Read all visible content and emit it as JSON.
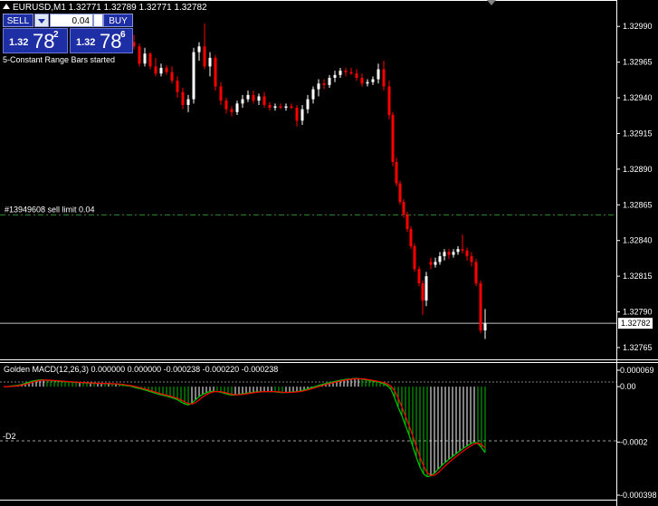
{
  "window": {
    "title": "EURUSD,M1  1.32771 1.32789 1.32771 1.32782"
  },
  "trade_panel": {
    "sell_label": "SELL",
    "buy_label": "BUY",
    "lot_value": "0.04",
    "bid_prefix": "1.32",
    "bid_big": "78",
    "bid_sup": "2",
    "ask_prefix": "1.32",
    "ask_big": "78",
    "ask_sup": "6"
  },
  "journal_text": "5-Constant Range Bars started",
  "order_line": {
    "label": "#13949608 sell limit 0.04",
    "price": 1.32858
  },
  "price_axis": {
    "ticks": [
      "1.32990",
      "1.32965",
      "1.32940",
      "1.32915",
      "1.32890",
      "1.32865",
      "1.32840",
      "1.32815",
      "1.32790",
      "1.32765"
    ],
    "current_price_label": "1.32782",
    "current_price": 1.32782
  },
  "indicator": {
    "label": "Golden MACD(12,26,3) 0.000000 0.000000 -0.000238 -0.000220 -0.000238",
    "level_label": "-D2",
    "axis_ticks": [
      "0.000069",
      "0.00",
      "-0.0002",
      "-0.000398"
    ]
  },
  "colors": {
    "background": "#000000",
    "bull_candle": "#ffffff",
    "bear_candle": "#ff0000",
    "order_line": "#2e8b2e",
    "macd_up": "#ffffff",
    "macd_down": "#00c000",
    "signal": "#ff0000",
    "panel_blue": "#1e2fa5"
  },
  "chart_data": {
    "type": "candlestick",
    "ylim": [
      1.32758,
      1.33006
    ],
    "candles": [
      {
        "x": 148,
        "o": 1.32979,
        "h": 1.32984,
        "l": 1.32974,
        "c": 1.32976
      },
      {
        "x": 154,
        "o": 1.32976,
        "h": 1.32978,
        "l": 1.32962,
        "c": 1.32964
      },
      {
        "x": 160,
        "o": 1.32964,
        "h": 1.32975,
        "l": 1.32962,
        "c": 1.32971
      },
      {
        "x": 166,
        "o": 1.32971,
        "h": 1.32972,
        "l": 1.3296,
        "c": 1.32962
      },
      {
        "x": 172,
        "o": 1.32962,
        "h": 1.32968,
        "l": 1.32955,
        "c": 1.32957
      },
      {
        "x": 178,
        "o": 1.32957,
        "h": 1.32964,
        "l": 1.32955,
        "c": 1.32961
      },
      {
        "x": 184,
        "o": 1.32961,
        "h": 1.32963,
        "l": 1.32956,
        "c": 1.32958
      },
      {
        "x": 190,
        "o": 1.32958,
        "h": 1.32962,
        "l": 1.3295,
        "c": 1.32952
      },
      {
        "x": 196,
        "o": 1.32952,
        "h": 1.32955,
        "l": 1.3294,
        "c": 1.32944
      },
      {
        "x": 202,
        "o": 1.32944,
        "h": 1.32947,
        "l": 1.32932,
        "c": 1.32935
      },
      {
        "x": 208,
        "o": 1.32935,
        "h": 1.32942,
        "l": 1.3293,
        "c": 1.32939
      },
      {
        "x": 214,
        "o": 1.32939,
        "h": 1.32975,
        "l": 1.32936,
        "c": 1.32972
      },
      {
        "x": 220,
        "o": 1.32972,
        "h": 1.32979,
        "l": 1.32966,
        "c": 1.32976
      },
      {
        "x": 226,
        "o": 1.32976,
        "h": 1.32992,
        "l": 1.3296,
        "c": 1.32962
      },
      {
        "x": 232,
        "o": 1.32962,
        "h": 1.32972,
        "l": 1.32955,
        "c": 1.32968
      },
      {
        "x": 238,
        "o": 1.32968,
        "h": 1.3297,
        "l": 1.32945,
        "c": 1.32948
      },
      {
        "x": 244,
        "o": 1.32948,
        "h": 1.32951,
        "l": 1.32935,
        "c": 1.32938
      },
      {
        "x": 250,
        "o": 1.32938,
        "h": 1.3294,
        "l": 1.32929,
        "c": 1.32932
      },
      {
        "x": 256,
        "o": 1.32932,
        "h": 1.32934,
        "l": 1.32927,
        "c": 1.3293
      },
      {
        "x": 262,
        "o": 1.3293,
        "h": 1.32938,
        "l": 1.32928,
        "c": 1.32936
      },
      {
        "x": 268,
        "o": 1.32936,
        "h": 1.32942,
        "l": 1.32933,
        "c": 1.32939
      },
      {
        "x": 274,
        "o": 1.32939,
        "h": 1.32945,
        "l": 1.32937,
        "c": 1.32942
      },
      {
        "x": 280,
        "o": 1.32942,
        "h": 1.32945,
        "l": 1.32936,
        "c": 1.32938
      },
      {
        "x": 286,
        "o": 1.32938,
        "h": 1.32943,
        "l": 1.32935,
        "c": 1.32941
      },
      {
        "x": 292,
        "o": 1.32941,
        "h": 1.32944,
        "l": 1.32933,
        "c": 1.32935
      },
      {
        "x": 298,
        "o": 1.32935,
        "h": 1.32937,
        "l": 1.32931,
        "c": 1.32933
      },
      {
        "x": 304,
        "o": 1.32933,
        "h": 1.32936,
        "l": 1.32931,
        "c": 1.32934
      },
      {
        "x": 310,
        "o": 1.32934,
        "h": 1.32936,
        "l": 1.32932,
        "c": 1.32933
      },
      {
        "x": 316,
        "o": 1.32933,
        "h": 1.32936,
        "l": 1.32931,
        "c": 1.32934
      },
      {
        "x": 322,
        "o": 1.32934,
        "h": 1.32936,
        "l": 1.32932,
        "c": 1.32933
      },
      {
        "x": 328,
        "o": 1.32933,
        "h": 1.32935,
        "l": 1.3292,
        "c": 1.32924
      },
      {
        "x": 334,
        "o": 1.32924,
        "h": 1.32935,
        "l": 1.32921,
        "c": 1.32932
      },
      {
        "x": 340,
        "o": 1.32932,
        "h": 1.32942,
        "l": 1.32929,
        "c": 1.32939
      },
      {
        "x": 346,
        "o": 1.32939,
        "h": 1.32948,
        "l": 1.32936,
        "c": 1.32946
      },
      {
        "x": 352,
        "o": 1.32946,
        "h": 1.32953,
        "l": 1.32941,
        "c": 1.3295
      },
      {
        "x": 358,
        "o": 1.3295,
        "h": 1.32953,
        "l": 1.32946,
        "c": 1.32949
      },
      {
        "x": 364,
        "o": 1.32949,
        "h": 1.32956,
        "l": 1.32947,
        "c": 1.32954
      },
      {
        "x": 370,
        "o": 1.32954,
        "h": 1.32959,
        "l": 1.32951,
        "c": 1.32956
      },
      {
        "x": 376,
        "o": 1.32956,
        "h": 1.32961,
        "l": 1.32954,
        "c": 1.32959
      },
      {
        "x": 382,
        "o": 1.32959,
        "h": 1.32961,
        "l": 1.32955,
        "c": 1.32958
      },
      {
        "x": 388,
        "o": 1.32958,
        "h": 1.32961,
        "l": 1.32956,
        "c": 1.32957
      },
      {
        "x": 394,
        "o": 1.32957,
        "h": 1.3296,
        "l": 1.32952,
        "c": 1.32954
      },
      {
        "x": 400,
        "o": 1.32954,
        "h": 1.32957,
        "l": 1.32948,
        "c": 1.3295
      },
      {
        "x": 406,
        "o": 1.3295,
        "h": 1.32953,
        "l": 1.32948,
        "c": 1.32951
      },
      {
        "x": 412,
        "o": 1.32951,
        "h": 1.32955,
        "l": 1.32949,
        "c": 1.32953
      },
      {
        "x": 418,
        "o": 1.32953,
        "h": 1.32964,
        "l": 1.3295,
        "c": 1.3296
      },
      {
        "x": 424,
        "o": 1.3296,
        "h": 1.32966,
        "l": 1.32945,
        "c": 1.32948
      },
      {
        "x": 430,
        "o": 1.32948,
        "h": 1.32952,
        "l": 1.32925,
        "c": 1.32928
      },
      {
        "x": 434,
        "o": 1.32928,
        "h": 1.3293,
        "l": 1.32892,
        "c": 1.32895
      },
      {
        "x": 438,
        "o": 1.32895,
        "h": 1.32898,
        "l": 1.32878,
        "c": 1.3288
      },
      {
        "x": 442,
        "o": 1.3288,
        "h": 1.32882,
        "l": 1.32865,
        "c": 1.32867
      },
      {
        "x": 446,
        "o": 1.32867,
        "h": 1.32869,
        "l": 1.32856,
        "c": 1.32858
      },
      {
        "x": 450,
        "o": 1.32858,
        "h": 1.3286,
        "l": 1.32846,
        "c": 1.32848
      },
      {
        "x": 454,
        "o": 1.32848,
        "h": 1.3285,
        "l": 1.32834,
        "c": 1.32836
      },
      {
        "x": 458,
        "o": 1.32836,
        "h": 1.32838,
        "l": 1.32818,
        "c": 1.3282
      },
      {
        "x": 463,
        "o": 1.3282,
        "h": 1.32822,
        "l": 1.32808,
        "c": 1.3281
      },
      {
        "x": 467,
        "o": 1.3281,
        "h": 1.32812,
        "l": 1.32788,
        "c": 1.32798
      },
      {
        "x": 471,
        "o": 1.32798,
        "h": 1.32818,
        "l": 1.32794,
        "c": 1.32815
      },
      {
        "x": 476,
        "o": 1.32825,
        "h": 1.32828,
        "l": 1.3282,
        "c": 1.32823
      },
      {
        "x": 481,
        "o": 1.32823,
        "h": 1.32828,
        "l": 1.32821,
        "c": 1.32825
      },
      {
        "x": 486,
        "o": 1.32825,
        "h": 1.32832,
        "l": 1.32823,
        "c": 1.32829
      },
      {
        "x": 491,
        "o": 1.32829,
        "h": 1.32834,
        "l": 1.32826,
        "c": 1.32832
      },
      {
        "x": 496,
        "o": 1.32832,
        "h": 1.32834,
        "l": 1.32827,
        "c": 1.3283
      },
      {
        "x": 501,
        "o": 1.3283,
        "h": 1.32834,
        "l": 1.32828,
        "c": 1.32832
      },
      {
        "x": 506,
        "o": 1.32832,
        "h": 1.32836,
        "l": 1.3283,
        "c": 1.32834
      },
      {
        "x": 511,
        "o": 1.32834,
        "h": 1.32844,
        "l": 1.32831,
        "c": 1.32833
      },
      {
        "x": 516,
        "o": 1.32833,
        "h": 1.32835,
        "l": 1.32826,
        "c": 1.32829
      },
      {
        "x": 521,
        "o": 1.32829,
        "h": 1.32832,
        "l": 1.32822,
        "c": 1.32825
      },
      {
        "x": 526,
        "o": 1.32825,
        "h": 1.32827,
        "l": 1.32808,
        "c": 1.3281
      },
      {
        "x": 531,
        "o": 1.3281,
        "h": 1.32812,
        "l": 1.32775,
        "c": 1.32777
      },
      {
        "x": 536,
        "o": 1.32777,
        "h": 1.32792,
        "l": 1.32771,
        "c": 1.32782
      }
    ],
    "macd": {
      "ylim": [
        -0.000398,
        6.9e-05
      ],
      "histogram": [
        {
          "x": 4,
          "v": 0.0
        },
        {
          "x": 8,
          "v": 0.0
        },
        {
          "x": 12,
          "v": 2e-06
        },
        {
          "x": 16,
          "v": 3e-06
        },
        {
          "x": 20,
          "v": 5e-06
        },
        {
          "x": 24,
          "v": 8e-06
        },
        {
          "x": 28,
          "v": 1.2e-05
        },
        {
          "x": 32,
          "v": 1.6e-05
        },
        {
          "x": 36,
          "v": 2e-05
        },
        {
          "x": 40,
          "v": 2.2e-05
        },
        {
          "x": 44,
          "v": 2.4e-05
        },
        {
          "x": 48,
          "v": 2.4e-05
        },
        {
          "x": 52,
          "v": 2.3e-05
        },
        {
          "x": 56,
          "v": 2.2e-05
        },
        {
          "x": 60,
          "v": 2.1e-05
        },
        {
          "x": 64,
          "v": 2e-05
        },
        {
          "x": 68,
          "v": 1.9e-05
        },
        {
          "x": 72,
          "v": 1.8e-05
        },
        {
          "x": 76,
          "v": 1.7e-05
        },
        {
          "x": 80,
          "v": 1.6e-05
        },
        {
          "x": 84,
          "v": 1.5e-05
        },
        {
          "x": 88,
          "v": 1.5e-05
        },
        {
          "x": 92,
          "v": 1.4e-05
        },
        {
          "x": 96,
          "v": 1.3e-05
        },
        {
          "x": 100,
          "v": 1.3e-05
        },
        {
          "x": 104,
          "v": 1.2e-05
        },
        {
          "x": 108,
          "v": 1.2e-05
        },
        {
          "x": 112,
          "v": 1.2e-05
        },
        {
          "x": 116,
          "v": 1.1e-05
        },
        {
          "x": 120,
          "v": 1.1e-05
        },
        {
          "x": 124,
          "v": 1e-05
        },
        {
          "x": 128,
          "v": 1e-05
        },
        {
          "x": 132,
          "v": 8e-06
        },
        {
          "x": 136,
          "v": 6e-06
        },
        {
          "x": 140,
          "v": 4e-06
        },
        {
          "x": 144,
          "v": 2e-06
        },
        {
          "x": 148,
          "v": -2e-06
        },
        {
          "x": 152,
          "v": -5e-06
        },
        {
          "x": 156,
          "v": -8e-06
        },
        {
          "x": 160,
          "v": -1.2e-05
        },
        {
          "x": 164,
          "v": -1.6e-05
        },
        {
          "x": 168,
          "v": -2e-05
        },
        {
          "x": 172,
          "v": -2.4e-05
        },
        {
          "x": 176,
          "v": -2.8e-05
        },
        {
          "x": 180,
          "v": -3.1e-05
        },
        {
          "x": 184,
          "v": -3.4e-05
        },
        {
          "x": 188,
          "v": -3.8e-05
        },
        {
          "x": 192,
          "v": -4.2e-05
        },
        {
          "x": 196,
          "v": -4.7e-05
        },
        {
          "x": 200,
          "v": -5.5e-05
        },
        {
          "x": 204,
          "v": -6.2e-05
        },
        {
          "x": 208,
          "v": -6.6e-05
        },
        {
          "x": 212,
          "v": -6e-05
        },
        {
          "x": 216,
          "v": -4.8e-05
        },
        {
          "x": 220,
          "v": -3.6e-05
        },
        {
          "x": 224,
          "v": -2.8e-05
        },
        {
          "x": 228,
          "v": -2.2e-05
        },
        {
          "x": 232,
          "v": -1.8e-05
        },
        {
          "x": 236,
          "v": -1.7e-05
        },
        {
          "x": 240,
          "v": -1.8e-05
        },
        {
          "x": 244,
          "v": -2e-05
        },
        {
          "x": 248,
          "v": -2.4e-05
        },
        {
          "x": 252,
          "v": -2.8e-05
        },
        {
          "x": 256,
          "v": -3e-05
        },
        {
          "x": 260,
          "v": -3e-05
        },
        {
          "x": 264,
          "v": -2.8e-05
        },
        {
          "x": 268,
          "v": -2.6e-05
        },
        {
          "x": 272,
          "v": -2.4e-05
        },
        {
          "x": 276,
          "v": -2.2e-05
        },
        {
          "x": 280,
          "v": -2e-05
        },
        {
          "x": 284,
          "v": -1.9e-05
        },
        {
          "x": 288,
          "v": -1.8e-05
        },
        {
          "x": 292,
          "v": -1.8e-05
        },
        {
          "x": 296,
          "v": -1.8e-05
        },
        {
          "x": 300,
          "v": -1.8e-05
        },
        {
          "x": 304,
          "v": -1.9e-05
        },
        {
          "x": 308,
          "v": -2e-05
        },
        {
          "x": 312,
          "v": -2.1e-05
        },
        {
          "x": 316,
          "v": -2.1e-05
        },
        {
          "x": 320,
          "v": -2e-05
        },
        {
          "x": 324,
          "v": -1.9e-05
        },
        {
          "x": 328,
          "v": -1.8e-05
        },
        {
          "x": 332,
          "v": -1.6e-05
        },
        {
          "x": 336,
          "v": -1.2e-05
        },
        {
          "x": 340,
          "v": -8e-06
        },
        {
          "x": 344,
          "v": -4e-06
        },
        {
          "x": 348,
          "v": 0.0
        },
        {
          "x": 352,
          "v": 4e-06
        },
        {
          "x": 356,
          "v": 8e-06
        },
        {
          "x": 360,
          "v": 1.1e-05
        },
        {
          "x": 364,
          "v": 1.4e-05
        },
        {
          "x": 368,
          "v": 1.7e-05
        },
        {
          "x": 372,
          "v": 2e-05
        },
        {
          "x": 376,
          "v": 2.3e-05
        },
        {
          "x": 380,
          "v": 2.5e-05
        },
        {
          "x": 384,
          "v": 2.7e-05
        },
        {
          "x": 388,
          "v": 2.8e-05
        },
        {
          "x": 392,
          "v": 2.9e-05
        },
        {
          "x": 396,
          "v": 2.9e-05
        },
        {
          "x": 400,
          "v": 2.7e-05
        },
        {
          "x": 404,
          "v": 2.5e-05
        },
        {
          "x": 408,
          "v": 2.2e-05
        },
        {
          "x": 412,
          "v": 2e-05
        },
        {
          "x": 416,
          "v": 1.8e-05
        },
        {
          "x": 420,
          "v": 1.5e-05
        },
        {
          "x": 424,
          "v": 1e-05
        },
        {
          "x": 428,
          "v": 4e-06
        },
        {
          "x": 432,
          "v": -1e-05
        },
        {
          "x": 436,
          "v": -4e-05
        },
        {
          "x": 440,
          "v": -7.5e-05
        },
        {
          "x": 444,
          "v": -0.000105
        },
        {
          "x": 448,
          "v": -0.00014
        },
        {
          "x": 452,
          "v": -0.000175
        },
        {
          "x": 456,
          "v": -0.000215
        },
        {
          "x": 460,
          "v": -0.000255
        },
        {
          "x": 464,
          "v": -0.00029
        },
        {
          "x": 468,
          "v": -0.000315
        },
        {
          "x": 472,
          "v": -0.000325
        },
        {
          "x": 476,
          "v": -0.000322
        },
        {
          "x": 480,
          "v": -0.000312
        },
        {
          "x": 484,
          "v": -0.000298
        },
        {
          "x": 488,
          "v": -0.000285
        },
        {
          "x": 492,
          "v": -0.000273
        },
        {
          "x": 496,
          "v": -0.000262
        },
        {
          "x": 500,
          "v": -0.000252
        },
        {
          "x": 504,
          "v": -0.000242
        },
        {
          "x": 508,
          "v": -0.000232
        },
        {
          "x": 512,
          "v": -0.000222
        },
        {
          "x": 516,
          "v": -0.000214
        },
        {
          "x": 520,
          "v": -0.000206
        },
        {
          "x": 524,
          "v": -0.0002
        },
        {
          "x": 528,
          "v": -0.000205
        },
        {
          "x": 532,
          "v": -0.00022
        },
        {
          "x": 536,
          "v": -0.000238
        }
      ]
    }
  }
}
